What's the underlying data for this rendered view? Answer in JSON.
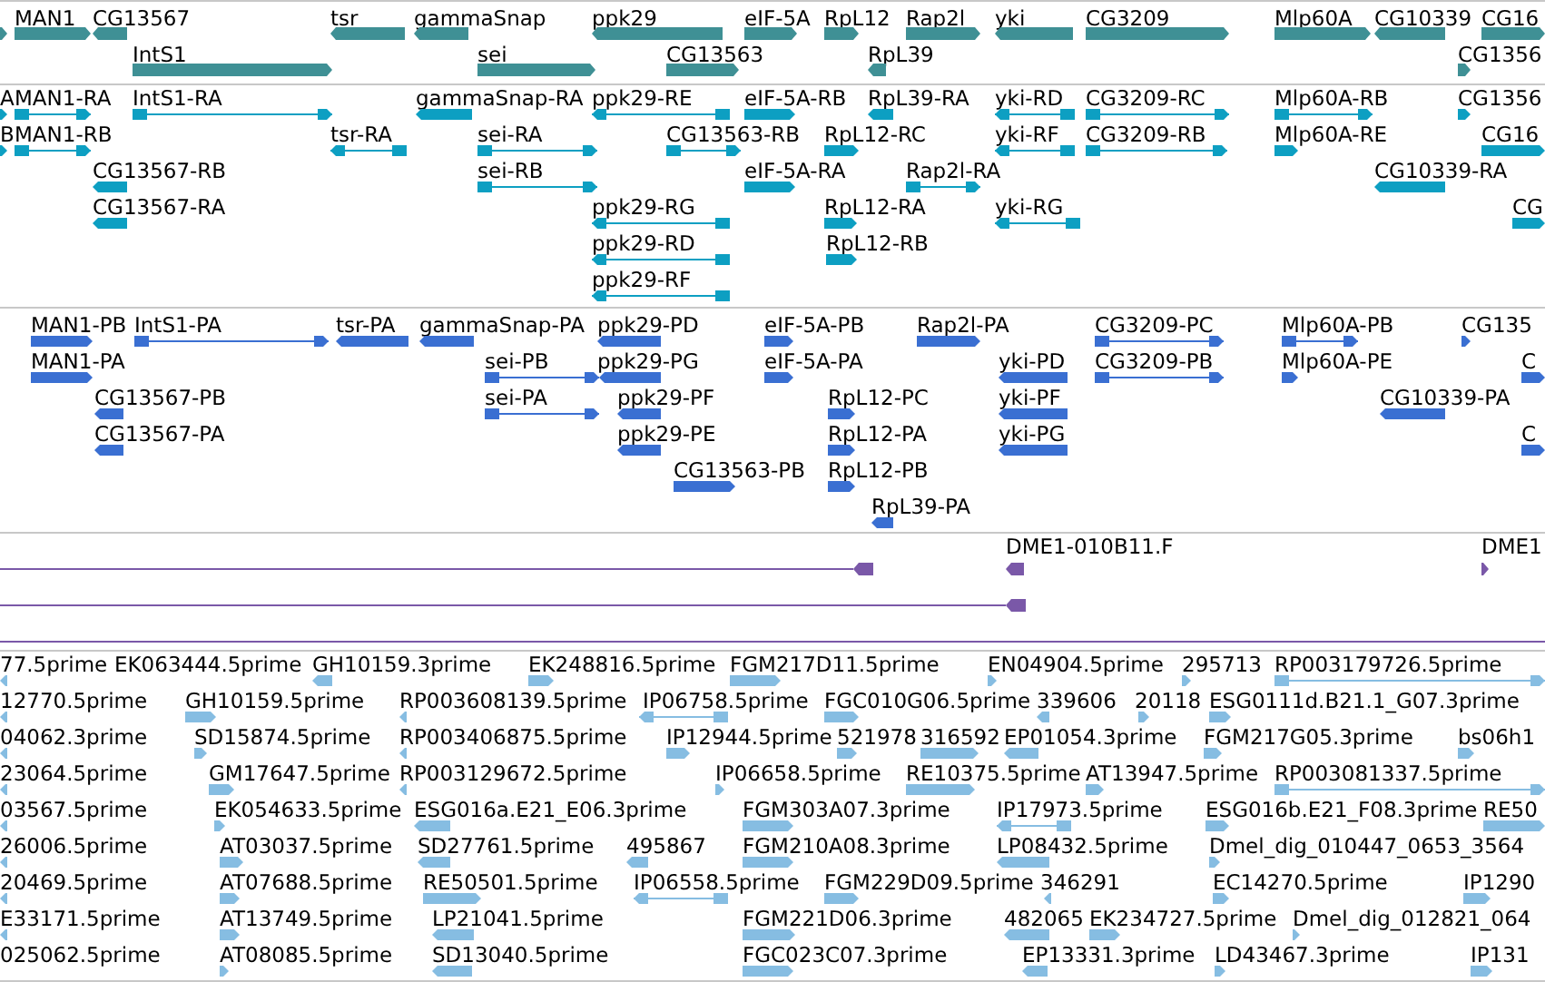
{
  "tracks": [
    {
      "kind": "gene",
      "features": [
        {
          "reverse": false
        },
        {
          "label": "MAN1",
          "reverse": false
        },
        {
          "label": "CG13567",
          "reverse": true
        },
        {
          "label": "tsr",
          "reverse": true
        },
        {
          "label": "gammaSnap",
          "reverse": true
        },
        {
          "label": "ppk29",
          "reverse": true
        },
        {
          "label": "eIF-5A",
          "reverse": false
        },
        {
          "label": "RpL12",
          "reverse": false
        },
        {
          "label": "Rap2l",
          "reverse": false
        },
        {
          "label": "yki",
          "reverse": true
        },
        {
          "label": "CG3209",
          "reverse": false
        },
        {
          "label": "Mlp60A",
          "reverse": false
        },
        {
          "label": "CG10339",
          "reverse": true
        },
        {
          "label": "CG16",
          "reverse": false
        },
        {
          "label": "IntS1",
          "reverse": false
        },
        {
          "label": "sei",
          "reverse": false
        },
        {
          "label": "CG13563",
          "reverse": false
        },
        {
          "label": "RpL39",
          "reverse": true
        },
        {
          "label": "CG1356",
          "reverse": false
        }
      ]
    },
    {
      "kind": "transcript",
      "features": [
        {
          "label": "A",
          "reverse": false
        },
        {
          "label": "MAN1-RA",
          "reverse": false
        },
        {
          "label": "IntS1-RA",
          "reverse": false
        },
        {
          "label": "gammaSnap-RA",
          "reverse": true
        },
        {
          "label": "ppk29-RE",
          "reverse": true
        },
        {
          "label": "eIF-5A-RB",
          "reverse": false
        },
        {
          "label": "RpL39-RA",
          "reverse": true
        },
        {
          "label": "yki-RD",
          "reverse": true
        },
        {
          "label": "CG3209-RC",
          "reverse": false
        },
        {
          "label": "Mlp60A-RB",
          "reverse": false
        },
        {
          "label": "CG1356",
          "reverse": false
        },
        {
          "label": "B",
          "reverse": false
        },
        {
          "label": "MAN1-RB",
          "reverse": false
        },
        {
          "label": "tsr-RA",
          "reverse": true
        },
        {
          "label": "sei-RA",
          "reverse": false
        },
        {
          "label": "CG13563-RB",
          "reverse": false
        },
        {
          "label": "RpL12-RC",
          "reverse": false
        },
        {
          "label": "yki-RF",
          "reverse": true
        },
        {
          "label": "CG3209-RB",
          "reverse": false
        },
        {
          "label": "Mlp60A-RE",
          "reverse": false
        },
        {
          "label": "CG16",
          "reverse": false
        },
        {
          "label": "CG13567-RB",
          "reverse": true
        },
        {
          "label": "sei-RB",
          "reverse": false
        },
        {
          "label": "eIF-5A-RA",
          "reverse": false
        },
        {
          "label": "Rap2l-RA",
          "reverse": false
        },
        {
          "label": "CG10339-RA",
          "reverse": true
        },
        {
          "label": "CG13567-RA",
          "reverse": true
        },
        {
          "label": "ppk29-RG",
          "reverse": true
        },
        {
          "label": "RpL12-RA",
          "reverse": false
        },
        {
          "label": "yki-RG",
          "reverse": true
        },
        {
          "label": "CG",
          "reverse": false
        },
        {
          "label": "ppk29-RD",
          "reverse": true
        },
        {
          "label": "RpL12-RB",
          "reverse": false
        },
        {
          "label": "ppk29-RF",
          "reverse": true
        }
      ]
    },
    {
      "kind": "protein",
      "features": [
        {
          "label": "MAN1-PB",
          "reverse": false
        },
        {
          "label": "IntS1-PA",
          "reverse": false
        },
        {
          "label": "tsr-PA",
          "reverse": true
        },
        {
          "label": "gammaSnap-PA",
          "reverse": true
        },
        {
          "label": "ppk29-PD",
          "reverse": true
        },
        {
          "label": "eIF-5A-PB",
          "reverse": false
        },
        {
          "label": "Rap2l-PA",
          "reverse": false
        },
        {
          "label": "CG3209-PC",
          "reverse": false
        },
        {
          "label": "Mlp60A-PB",
          "reverse": false
        },
        {
          "label": "CG135",
          "reverse": false
        },
        {
          "label": "MAN1-PA",
          "reverse": false
        },
        {
          "label": "sei-PB",
          "reverse": false
        },
        {
          "label": "ppk29-PG",
          "reverse": true
        },
        {
          "label": "eIF-5A-PA",
          "reverse": false
        },
        {
          "label": "yki-PD",
          "reverse": true
        },
        {
          "label": "CG3209-PB",
          "reverse": false
        },
        {
          "label": "Mlp60A-PE",
          "reverse": false
        },
        {
          "label": "C",
          "reverse": false
        },
        {
          "label": "CG13567-PB",
          "reverse": true
        },
        {
          "label": "sei-PA",
          "reverse": false
        },
        {
          "label": "ppk29-PF",
          "reverse": true
        },
        {
          "label": "RpL12-PC",
          "reverse": false
        },
        {
          "label": "yki-PF",
          "reverse": true
        },
        {
          "label": "CG10339-PA",
          "reverse": true
        },
        {
          "label": "CG13567-PA",
          "reverse": true
        },
        {
          "label": "ppk29-PE",
          "reverse": true
        },
        {
          "label": "RpL12-PA",
          "reverse": false
        },
        {
          "label": "yki-PG",
          "reverse": true
        },
        {
          "label": "C",
          "reverse": false
        },
        {
          "label": "CG13563-PB",
          "reverse": false
        },
        {
          "label": "RpL12-PB",
          "reverse": false
        },
        {
          "label": "RpL39-PA",
          "reverse": true
        }
      ]
    },
    {
      "kind": "clone",
      "features": [
        {
          "reverse": true
        },
        {
          "label": "DME1-010B11.F",
          "reverse": true
        },
        {
          "label": "DME1",
          "reverse": false
        },
        {
          "reverse": true
        }
      ]
    },
    {
      "kind": "est",
      "features": [
        {
          "label": "77.5prime",
          "reverse": true
        },
        {
          "label": "EK063444.5prime"
        },
        {
          "label": "GH10159.3prime",
          "reverse": true
        },
        {
          "label": "EK248816.5prime",
          "reverse": false
        },
        {
          "label": "FGM217D11.5prime",
          "reverse": false
        },
        {
          "label": "EN04904.5prime",
          "reverse": false
        },
        {
          "label": "295713",
          "reverse": false
        },
        {
          "label": "RP003179726.5prime",
          "reverse": false
        },
        {
          "label": "12770.5prime",
          "reverse": true
        },
        {
          "label": "GH10159.5prime",
          "reverse": false
        },
        {
          "label": "RP003608139.5prime",
          "reverse": true
        },
        {
          "label": "IP06758.5prime",
          "reverse": true
        },
        {
          "label": "FGC010G06.5prime",
          "reverse": false
        },
        {
          "label": "339606",
          "reverse": true
        },
        {
          "label": "20118",
          "reverse": false
        },
        {
          "label": "ESG0111d.B21.1_G07.3prime",
          "reverse": false
        },
        {
          "label": "04062.3prime",
          "reverse": true
        },
        {
          "label": "SD15874.5prime",
          "reverse": false
        },
        {
          "label": "RP003406875.5prime",
          "reverse": true
        },
        {
          "label": "IP12944.5prime",
          "reverse": false
        },
        {
          "label": "521978",
          "reverse": false
        },
        {
          "label": "316592",
          "reverse": false
        },
        {
          "label": "EP01054.3prime",
          "reverse": true
        },
        {
          "label": "FGM217G05.3prime",
          "reverse": false
        },
        {
          "label": "bs06h1",
          "reverse": false
        },
        {
          "label": "23064.5prime",
          "reverse": true
        },
        {
          "label": "GM17647.5prime",
          "reverse": false
        },
        {
          "label": "RP003129672.5prime",
          "reverse": true
        },
        {
          "label": "IP06658.5prime",
          "reverse": false
        },
        {
          "label": "RE10375.5prime",
          "reverse": false
        },
        {
          "label": "AT13947.5prime",
          "reverse": false
        },
        {
          "label": "RP003081337.5prime",
          "reverse": false
        },
        {
          "label": "03567.5prime",
          "reverse": true
        },
        {
          "label": "EK054633.5prime",
          "reverse": false
        },
        {
          "label": "ESG016a.E21_E06.3prime",
          "reverse": true
        },
        {
          "label": "FGM303A07.3prime",
          "reverse": false
        },
        {
          "label": "IP17973.5prime",
          "reverse": true
        },
        {
          "label": "ESG016b.E21_F08.3prime",
          "reverse": false
        },
        {
          "label": "RE50",
          "reverse": false
        },
        {
          "label": "26006.5prime",
          "reverse": true
        },
        {
          "label": "AT03037.5prime",
          "reverse": false
        },
        {
          "label": "SD27761.5prime",
          "reverse": true
        },
        {
          "label": "495867",
          "reverse": true
        },
        {
          "label": "FGM210A08.3prime",
          "reverse": false
        },
        {
          "label": "LP08432.5prime",
          "reverse": true
        },
        {
          "label": "Dmel_dig_010447_0653_3564",
          "reverse": false
        },
        {
          "label": "20469.5prime",
          "reverse": true
        },
        {
          "label": "AT07688.5prime",
          "reverse": false
        },
        {
          "label": "RE50501.5prime",
          "reverse": false
        },
        {
          "label": "IP06558.5prime",
          "reverse": true
        },
        {
          "label": "FGM229D09.5prime",
          "reverse": false
        },
        {
          "label": "346291",
          "reverse": true
        },
        {
          "label": "EC14270.5prime",
          "reverse": false
        },
        {
          "label": "IP1290",
          "reverse": false
        },
        {
          "label": "E33171.5prime",
          "reverse": true
        },
        {
          "label": "AT13749.5prime",
          "reverse": false
        },
        {
          "label": "LP21041.5prime",
          "reverse": true
        },
        {
          "label": "FGM221D06.3prime",
          "reverse": false
        },
        {
          "label": "482065",
          "reverse": true
        },
        {
          "label": "EK234727.5prime",
          "reverse": false
        },
        {
          "label": "Dmel_dig_012821_064",
          "reverse": false
        },
        {
          "label": "025062.5prime"
        },
        {
          "label": "AT08085.5prime",
          "reverse": false
        },
        {
          "label": "SD13040.5prime",
          "reverse": true
        },
        {
          "label": "FGC023C07.3prime",
          "reverse": false
        },
        {
          "label": "EP13331.3prime",
          "reverse": true
        },
        {
          "label": "LD43467.3prime",
          "reverse": false
        },
        {
          "label": "IP131",
          "reverse": false
        }
      ]
    }
  ]
}
